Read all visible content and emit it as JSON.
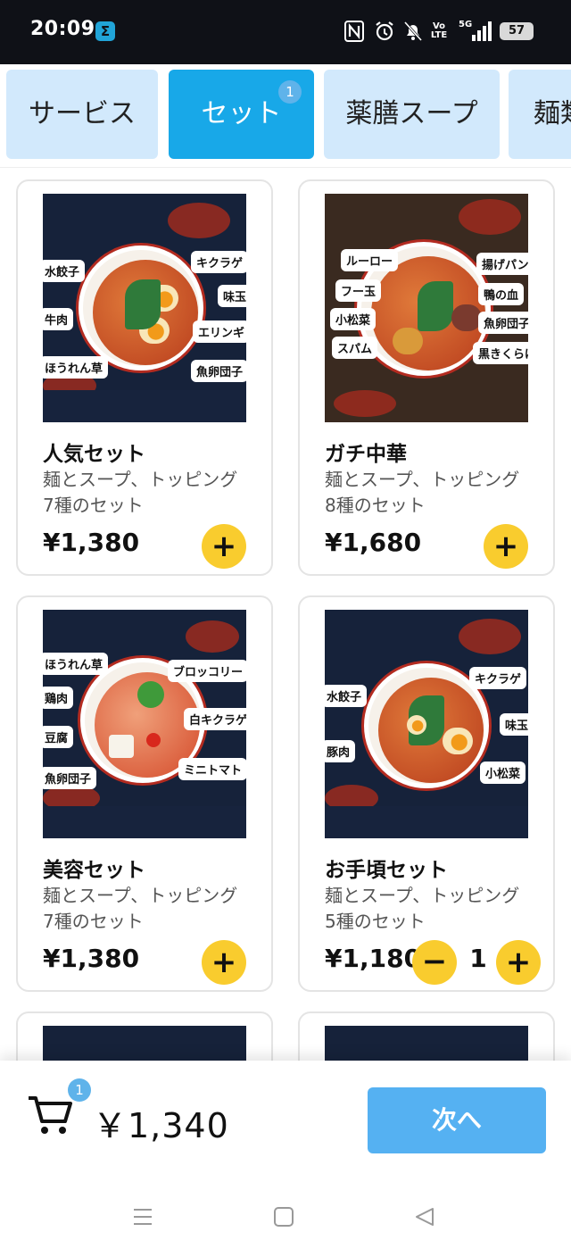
{
  "status_bar": {
    "time": "20:09",
    "app_icon_glyph": "Σ",
    "icons": [
      "nfc-icon",
      "alarm-icon",
      "mute-icon",
      "volte-icon",
      "5g-signal-icon"
    ],
    "volte_text": "Vo\nLTE",
    "network_text": "5G",
    "battery_level": "57"
  },
  "tabs": [
    {
      "label": "サービス",
      "active": false
    },
    {
      "label": "セット",
      "active": true,
      "badge": "1"
    },
    {
      "label": "薬膳スープ",
      "active": false
    },
    {
      "label": "麺類",
      "active": false
    }
  ],
  "products": [
    {
      "name": "人気セット",
      "desc": "麺とスープ、トッピング7種のセット",
      "price": "¥1,380",
      "tags": [
        "水餃子",
        "牛肉",
        "ほうれん草",
        "キクラゲ",
        "味玉",
        "エリンギ",
        "魚卵団子"
      ]
    },
    {
      "name": "ガチ中華",
      "desc": "麺とスープ、トッピング8種のセット",
      "price": "¥1,680",
      "tags": [
        "ルーロー",
        "フー玉",
        "小松菜",
        "スパム",
        "揚げパン",
        "鴨の血",
        "魚卵団子",
        "黒きくらげ"
      ]
    },
    {
      "name": "美容セット",
      "desc": "麺とスープ、トッピング7種のセット",
      "price": "¥1,380",
      "tags": [
        "ほうれん草",
        "鶏肉",
        "豆腐",
        "魚卵団子",
        "ブロッコリー",
        "白キクラゲ",
        "ミニトマト"
      ]
    },
    {
      "name": "お手頃セット",
      "desc": "麺とスープ、トッピング5種のセット",
      "price": "¥1,180",
      "quantity": "1",
      "tags": [
        "水餃子",
        "豚肉",
        "キクラゲ",
        "味玉",
        "小松菜"
      ]
    }
  ],
  "buttons": {
    "add": "+",
    "minus": "−"
  },
  "cart": {
    "badge": "1",
    "total": "￥1,340",
    "next_label": "次へ"
  },
  "colors": {
    "accent": "#18a8e8",
    "tab_bg": "#d2e9fc",
    "add_button": "#f9cc2e",
    "next_button": "#55b1f2",
    "badge": "#5fb3ea"
  }
}
